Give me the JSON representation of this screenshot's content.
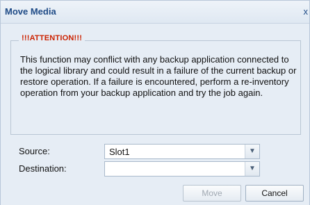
{
  "dialog": {
    "title": "Move Media",
    "close_glyph": "x"
  },
  "attention": {
    "legend": "!!!ATTENTION!!!",
    "message": "This function may conflict with any backup application connected to the logical library and could result in a failure of the current backup or restore operation. If a failure is encountered, perform a re-inventory operation from your backup application and try the job again."
  },
  "form": {
    "source_label": "Source:",
    "source_value": "Slot1",
    "destination_label": "Destination:",
    "destination_value": ""
  },
  "buttons": {
    "move_label": "Move",
    "cancel_label": "Cancel"
  },
  "icons": {
    "dropdown_arrow": "chevron-down-icon",
    "close": "close-icon"
  }
}
